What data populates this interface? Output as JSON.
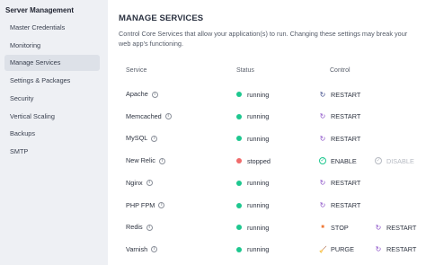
{
  "sidebar": {
    "title": "Server Management",
    "items": [
      {
        "label": "Master Credentials",
        "active": false
      },
      {
        "label": "Monitoring",
        "active": false
      },
      {
        "label": "Manage Services",
        "active": true
      },
      {
        "label": "Settings & Packages",
        "active": false
      },
      {
        "label": "Security",
        "active": false
      },
      {
        "label": "Vertical Scaling",
        "active": false
      },
      {
        "label": "Backups",
        "active": false
      },
      {
        "label": "SMTP",
        "active": false
      }
    ]
  },
  "main": {
    "title": "MANAGE SERVICES",
    "description": "Control Core Services that allow your application(s) to run. Changing these settings may break your web app's functioning.",
    "columns": {
      "service": "Service",
      "status": "Status",
      "control": "Control"
    },
    "info_icon_glyph": "i",
    "colors": {
      "running": "#1ec78f",
      "stopped": "#f06b6b",
      "restart_icon": "#3d4a8a",
      "purple_icon": "#8a4fc7",
      "stop_icon": "#ef7b3a",
      "enable_icon": "#1ec78f",
      "disabled_text": "#b6bac2"
    },
    "services": [
      {
        "name": "Apache",
        "status": "running",
        "state": "running",
        "actions": [
          {
            "label": "RESTART",
            "icon": "restart-icon",
            "glyph": "↻",
            "color": "#3d4a8a",
            "disabled": false
          }
        ]
      },
      {
        "name": "Memcached",
        "status": "running",
        "state": "running",
        "actions": [
          {
            "label": "RESTART",
            "icon": "restart-icon",
            "glyph": "↻",
            "color": "#8a4fc7",
            "disabled": false
          }
        ]
      },
      {
        "name": "MySQL",
        "status": "running",
        "state": "running",
        "actions": [
          {
            "label": "RESTART",
            "icon": "restart-icon",
            "glyph": "↻",
            "color": "#8a4fc7",
            "disabled": false
          }
        ]
      },
      {
        "name": "New Relic",
        "status": "stopped",
        "state": "stopped",
        "actions": [
          {
            "label": "ENABLE",
            "icon": "enable-check-icon",
            "glyph": "✓",
            "color": "#1ec78f",
            "disabled": false
          },
          {
            "label": "DISABLE",
            "icon": "disable-check-icon",
            "glyph": "✓",
            "color": "#b6bac2",
            "disabled": true
          }
        ]
      },
      {
        "name": "Nginx",
        "status": "running",
        "state": "running",
        "actions": [
          {
            "label": "RESTART",
            "icon": "restart-icon",
            "glyph": "↻",
            "color": "#8a4fc7",
            "disabled": false
          }
        ]
      },
      {
        "name": "PHP FPM",
        "status": "running",
        "state": "running",
        "actions": [
          {
            "label": "RESTART",
            "icon": "restart-icon",
            "glyph": "↻",
            "color": "#8a4fc7",
            "disabled": false
          }
        ]
      },
      {
        "name": "Redis",
        "status": "running",
        "state": "running",
        "actions": [
          {
            "label": "STOP",
            "icon": "stop-icon",
            "glyph": "■",
            "color": "#ef7b3a",
            "disabled": false
          },
          {
            "label": "RESTART",
            "icon": "restart-icon",
            "glyph": "↻",
            "color": "#8a4fc7",
            "disabled": false
          }
        ]
      },
      {
        "name": "Varnish",
        "status": "running",
        "state": "running",
        "actions": [
          {
            "label": "PURGE",
            "icon": "purge-broom-icon",
            "glyph": "🧹",
            "color": "#ef7b3a",
            "disabled": false
          },
          {
            "label": "RESTART",
            "icon": "restart-icon",
            "glyph": "↻",
            "color": "#8a4fc7",
            "disabled": false
          }
        ]
      }
    ]
  }
}
